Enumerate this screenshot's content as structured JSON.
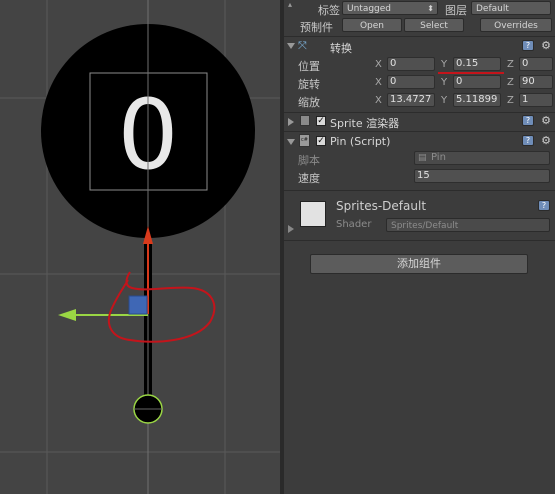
{
  "scene": {
    "pin_number": "0"
  },
  "inspector": {
    "tag_label": "标签",
    "tag_value": "Untagged",
    "layer_label": "图层",
    "layer_value": "Default",
    "prefab_label": "预制件",
    "prefab_open": "Open",
    "prefab_select": "Select",
    "prefab_overrides": "Overrides",
    "transform": {
      "title": "转换",
      "position_label": "位置",
      "rotation_label": "旋转",
      "scale_label": "缩放",
      "axis_x": "X",
      "axis_y": "Y",
      "axis_z": "Z",
      "position": {
        "x": "0",
        "y": "0.15",
        "z": "0"
      },
      "rotation": {
        "x": "0",
        "y": "0",
        "z": "90"
      },
      "scale": {
        "x": "13.4727",
        "y": "5.11899",
        "z": "1"
      }
    },
    "sprite_renderer": {
      "title": "Sprite 渲染器"
    },
    "pin_script": {
      "title": "Pin (Script)",
      "script_label": "脚本",
      "script_value": "Pin",
      "speed_label": "速度",
      "speed_value": "15"
    },
    "material": {
      "name": "Sprites-Default",
      "shader_label": "Shader",
      "shader_value": "Sprites/Default"
    },
    "add_component": "添加组件"
  },
  "colors": {
    "annotation_red": "#c4141b",
    "gizmo_green": "#9ad644",
    "gizmo_red": "#d93a1c"
  }
}
